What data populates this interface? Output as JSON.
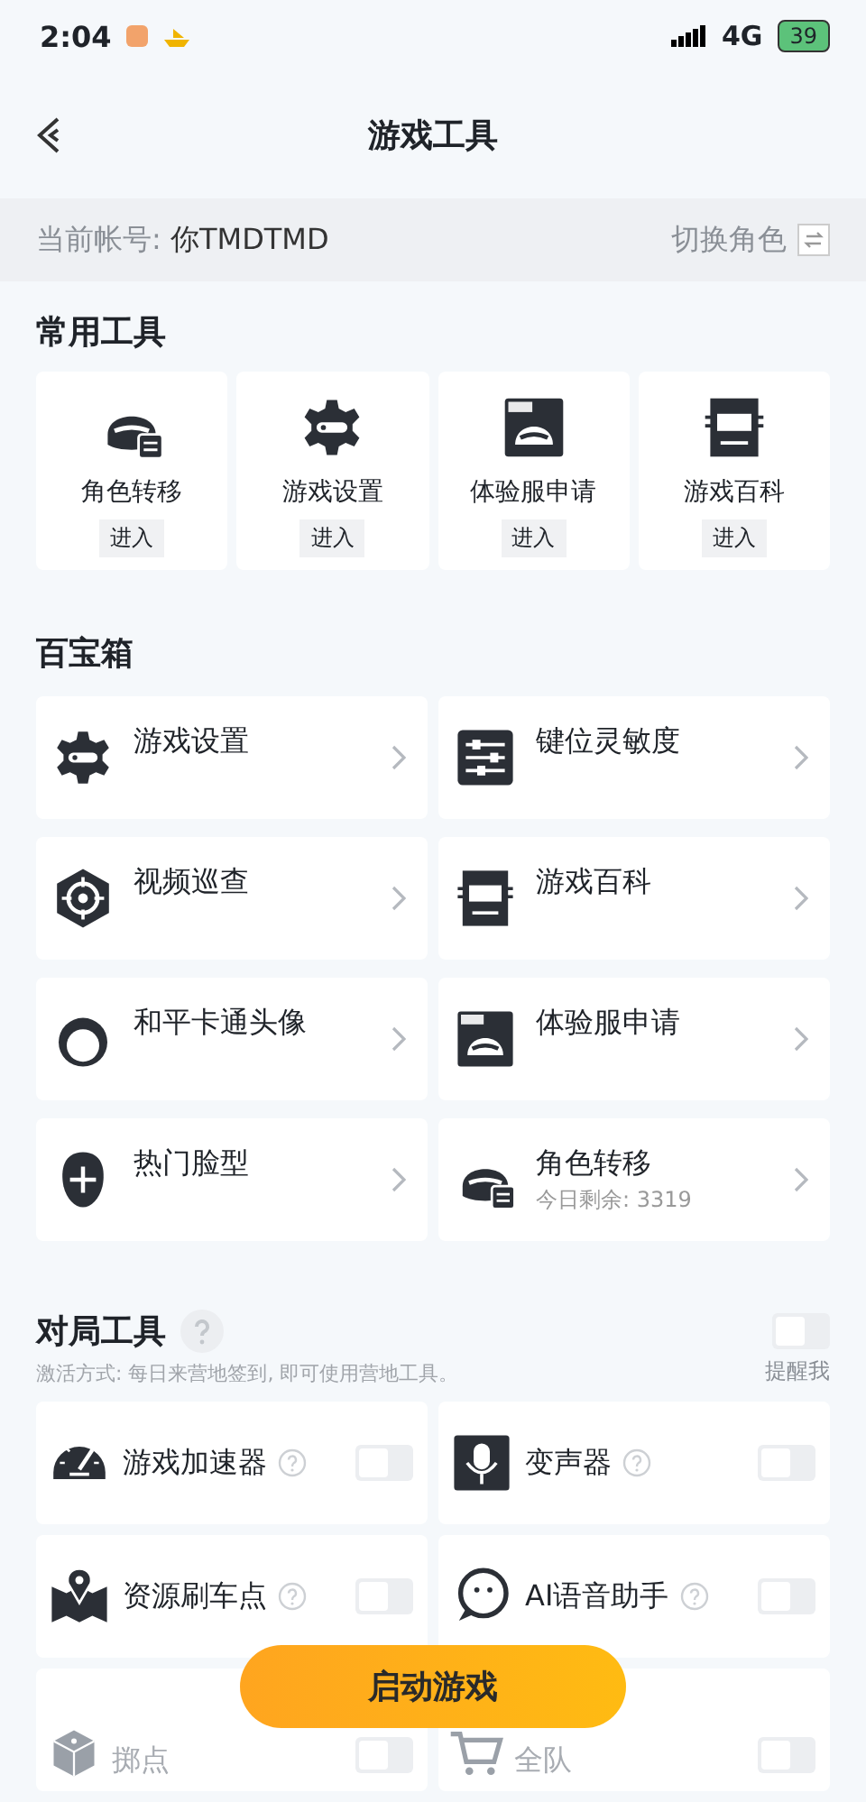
{
  "status_bar": {
    "time": "2:04",
    "network": "4G",
    "battery": "39"
  },
  "nav": {
    "title": "游戏工具"
  },
  "account": {
    "label": "当前帐号: ",
    "name": "你TMDTMD",
    "switch": "切换角色"
  },
  "common_tools": {
    "title": "常用工具",
    "items": [
      {
        "label": "角色转移",
        "action": "进入"
      },
      {
        "label": "游戏设置",
        "action": "进入"
      },
      {
        "label": "体验服申请",
        "action": "进入"
      },
      {
        "label": "游戏百科",
        "action": "进入"
      }
    ]
  },
  "toolbox": {
    "title": "百宝箱",
    "items": [
      {
        "label": "游戏设置"
      },
      {
        "label": "键位灵敏度"
      },
      {
        "label": "视频巡查"
      },
      {
        "label": "游戏百科"
      },
      {
        "label": "和平卡通头像"
      },
      {
        "label": "体验服申请"
      },
      {
        "label": "热门脸型"
      },
      {
        "label": "角色转移",
        "sub": "今日剩余: 3319"
      }
    ]
  },
  "battle_tools": {
    "title": "对局工具",
    "hint": "激活方式: 每日来营地签到, 即可使用营地工具。",
    "remind": {
      "label": "提醒我",
      "on": false
    },
    "items": [
      {
        "label": "游戏加速器",
        "on": false
      },
      {
        "label": "变声器",
        "on": false
      },
      {
        "label": "资源刷车点",
        "on": false
      },
      {
        "label": "AI语音助手",
        "on": false
      },
      {
        "label": "掷点",
        "on": false
      },
      {
        "label": "全队",
        "on": false
      }
    ]
  },
  "start_button": "启动游戏"
}
